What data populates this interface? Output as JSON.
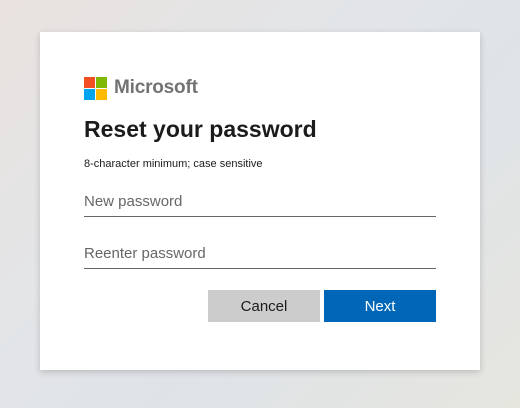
{
  "logo": {
    "text": "Microsoft",
    "colors": [
      "#f25022",
      "#7fba00",
      "#00a4ef",
      "#ffb900"
    ]
  },
  "title": "Reset your password",
  "subtitle": "8-character minimum; case sensitive",
  "fields": {
    "new_password": {
      "placeholder": "New password",
      "value": ""
    },
    "reenter_password": {
      "placeholder": "Reenter password",
      "value": ""
    }
  },
  "buttons": {
    "cancel": "Cancel",
    "next": "Next"
  },
  "colors": {
    "primary": "#0067b8",
    "secondary": "#cccccc"
  }
}
